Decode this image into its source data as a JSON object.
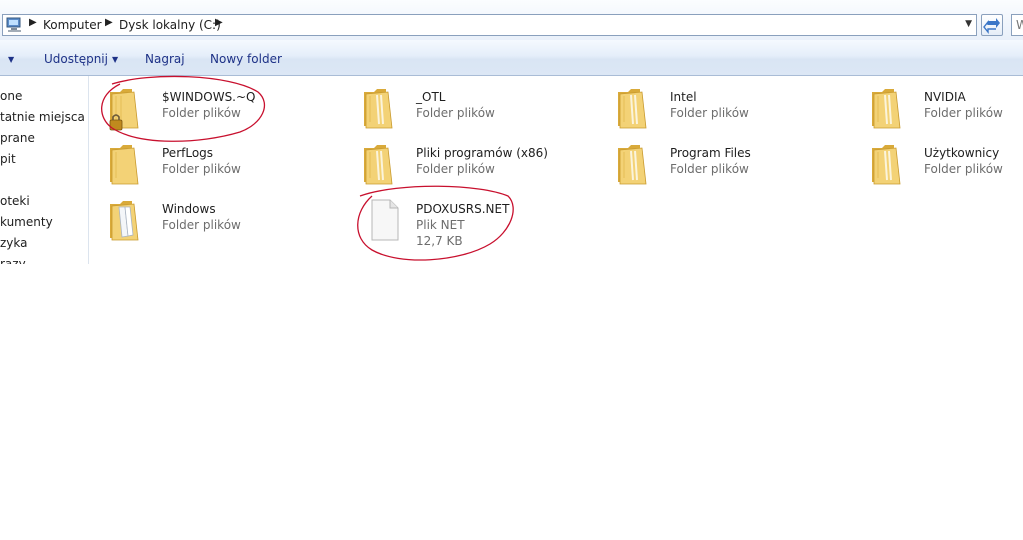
{
  "address_bar": {
    "breadcrumbs": [
      "Komputer",
      "Dysk lokalny (C:)"
    ],
    "search_partial": "W"
  },
  "toolbar": {
    "items": [
      "Udostępnij",
      "Nagraj",
      "Nowy folder"
    ]
  },
  "nav_pane": {
    "items": [
      "one",
      "tatnie miejsca",
      "prane",
      "pit",
      "oteki",
      "kumenty",
      "zyka",
      "razy"
    ]
  },
  "files": [
    {
      "name": "$WINDOWS.~Q",
      "type": "Folder plików",
      "icon": "locked-folder-icon"
    },
    {
      "name": "_OTL",
      "type": "Folder plików",
      "icon": "folder-icon"
    },
    {
      "name": "Intel",
      "type": "Folder plików",
      "icon": "folder-icon"
    },
    {
      "name": "NVIDIA",
      "type": "Folder plików",
      "icon": "folder-icon"
    },
    {
      "name": "PerfLogs",
      "type": "Folder plików",
      "icon": "folder-icon"
    },
    {
      "name": "Pliki programów (x86)",
      "type": "Folder plików",
      "icon": "folder-icon"
    },
    {
      "name": "Program Files",
      "type": "Folder plików",
      "icon": "folder-icon"
    },
    {
      "name": "Użytkownicy",
      "type": "Folder plików",
      "icon": "folder-icon"
    },
    {
      "name": "Windows",
      "type": "Folder plików",
      "icon": "folder-icon"
    },
    {
      "name": "PDOXUSRS.NET",
      "type": "Plik NET",
      "size": "12,7 KB",
      "icon": "file-icon"
    }
  ],
  "colors": {
    "folder": "#f3d276",
    "folder_dark": "#d9aa3a",
    "annotation": "#c8102e",
    "link_text": "#1e3287"
  }
}
